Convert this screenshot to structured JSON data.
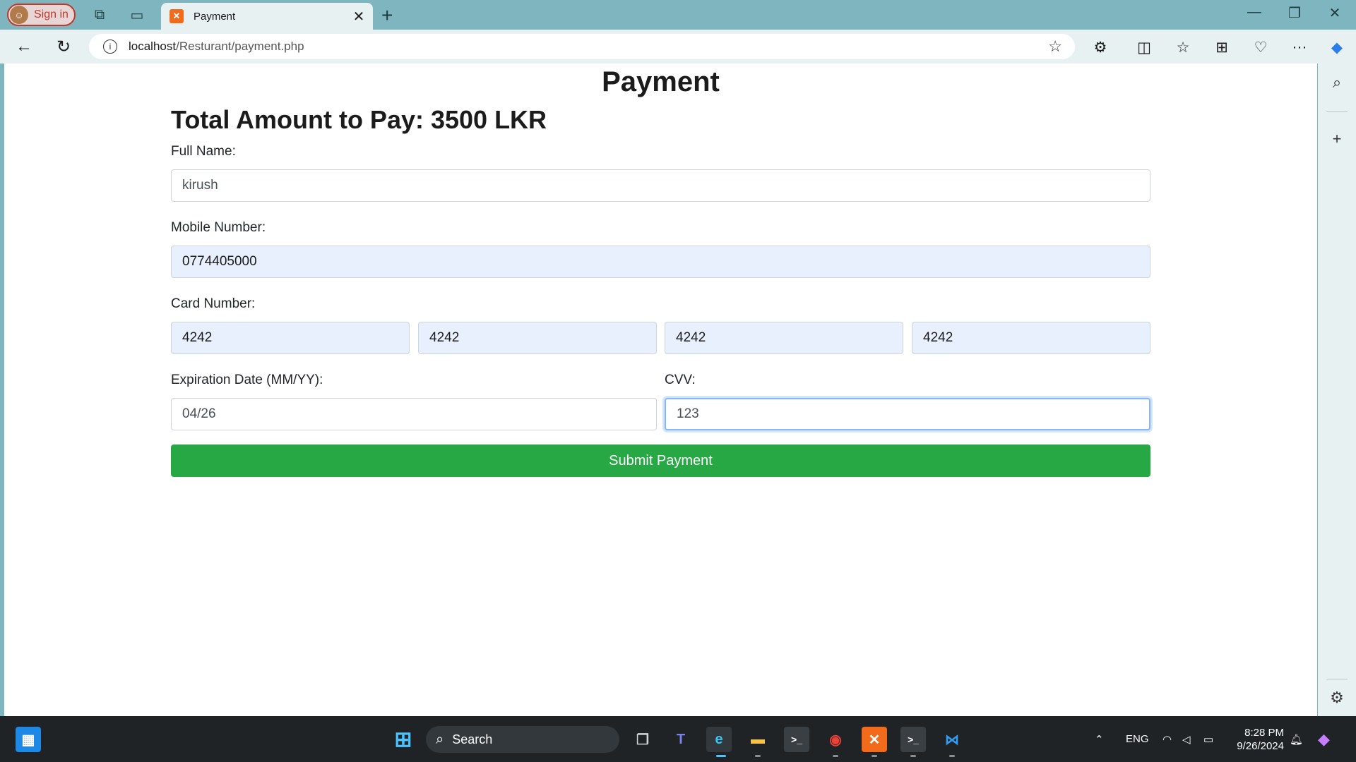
{
  "browser": {
    "signin_label": "Sign in",
    "tab_title": "Payment",
    "tab_favicon": "xampp-icon",
    "url_host": "localhost",
    "url_path": "/Resturant/payment.php"
  },
  "page": {
    "title": "Payment",
    "total_heading": "Total Amount to Pay: 3500 LKR",
    "full_name_label": "Full Name:",
    "full_name_value": "kirush",
    "mobile_label": "Mobile Number:",
    "mobile_value": "0774405000",
    "card_label": "Card Number:",
    "card_parts": [
      "4242",
      "4242",
      "4242",
      "4242"
    ],
    "expiry_label": "Expiration Date (MM/YY):",
    "expiry_value": "04/26",
    "cvv_label": "CVV:",
    "cvv_value": "123",
    "submit_label": "Submit Payment",
    "submit_color": "#28a745"
  },
  "taskbar": {
    "search_label": "Search",
    "lang": "ENG",
    "time": "8:28 PM",
    "date": "9/26/2024"
  }
}
